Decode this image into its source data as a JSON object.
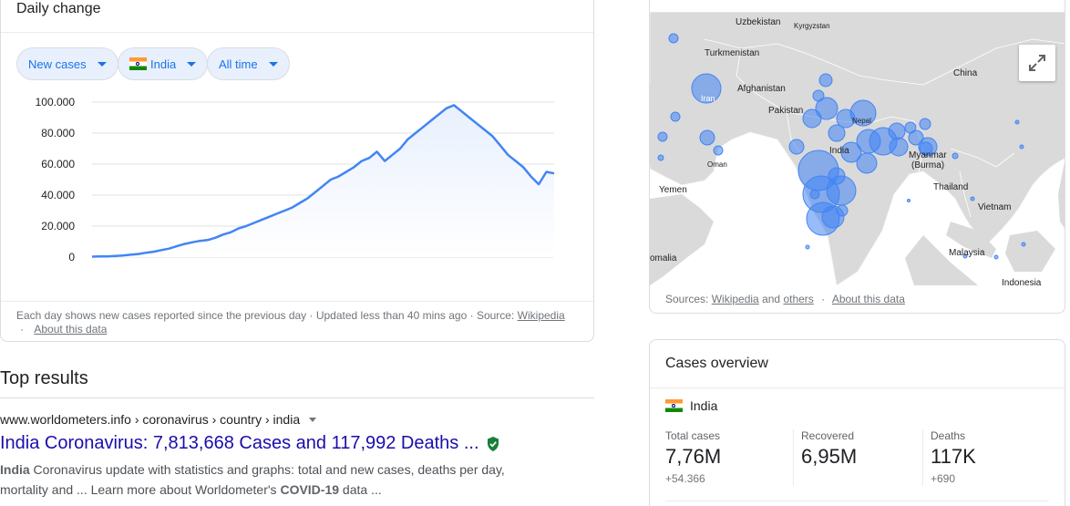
{
  "daily_change": {
    "title": "Daily change",
    "chips": {
      "metric": "New cases",
      "country": "India",
      "range": "All time"
    },
    "footer": {
      "text": "Each day shows new cases reported since the previous day · Updated less than 40 mins ago · Source:",
      "source_link": "Wikipedia",
      "about_link": "About this data"
    }
  },
  "chart_data": {
    "type": "area",
    "title": "",
    "xlabel": "",
    "ylabel": "",
    "ylim": [
      0,
      100000
    ],
    "y_ticks": [
      "100.000",
      "80.000",
      "60.000",
      "40.000",
      "20.000",
      "0"
    ],
    "y_tick_values": [
      100000,
      80000,
      60000,
      40000,
      20000,
      0
    ],
    "grid": true,
    "series": [
      {
        "values": [
          300,
          400,
          500,
          700,
          1000,
          1500,
          2000,
          2800,
          3500,
          4500,
          5500,
          7000,
          8500,
          9500,
          10500,
          11000,
          12500,
          14500,
          16000,
          18500,
          20000,
          22000,
          24000,
          26000,
          28000,
          30000,
          32000,
          35000,
          38000,
          42000,
          46000,
          50000,
          52000,
          55000,
          58000,
          62000,
          64000,
          68000,
          62000,
          66000,
          70000,
          76000,
          80000,
          84000,
          88000,
          92000,
          96000,
          98000,
          94000,
          90000,
          86000,
          82000,
          78000,
          72000,
          66000,
          62000,
          58000,
          52000,
          47000,
          55000,
          54000
        ]
      }
    ],
    "color": "#4285f4",
    "fill_color": "#e8f0fe"
  },
  "top_results": {
    "heading": "Top results",
    "result": {
      "url": "www.worldometers.info › coronavirus › country › india",
      "title": "India Coronavirus: 7,813,668 Cases and 117,992 Deaths ...",
      "snippet_prefix": "India",
      "snippet_mid": " Coronavirus update with statistics and graphs: total and new cases, deaths per day, mortality and ... Learn more about Worldometer's ",
      "snippet_bold2": "COVID-19",
      "snippet_suffix": " data ..."
    }
  },
  "map": {
    "labels": {
      "uzbekistan": "Uzbekistan",
      "kyrgyzstan": "Kyrgyzstan",
      "turkmenistan": "Turkmenistan",
      "china": "China",
      "afghanistan": "Afghanistan",
      "iran": "Iran",
      "pakistan": "Pakistan",
      "nepal": "Nepal",
      "india": "India",
      "oman": "Oman",
      "myanmar": "Myanmar\n(Burma)",
      "myanmar_line1": "Myanmar",
      "myanmar_line2": "(Burma)",
      "yemen": "Yemen",
      "thailand": "Thailand",
      "vietnam": "Vietnam",
      "somalia": "omalia",
      "malaysia": "Malaysia",
      "indonesia": "Indonesia"
    },
    "sources_prefix": "Sources:",
    "sources_link1": "Wikipedia",
    "sources_and": "and",
    "sources_link2": "others",
    "sources_about": "About this data"
  },
  "cases_overview": {
    "title": "Cases overview",
    "country": "India",
    "stats": {
      "total": {
        "label": "Total cases",
        "value": "7,76M",
        "delta": "+54.366"
      },
      "recovered": {
        "label": "Recovered",
        "value": "6,95M"
      },
      "deaths": {
        "label": "Deaths",
        "value": "117K",
        "delta": "+690"
      }
    }
  }
}
